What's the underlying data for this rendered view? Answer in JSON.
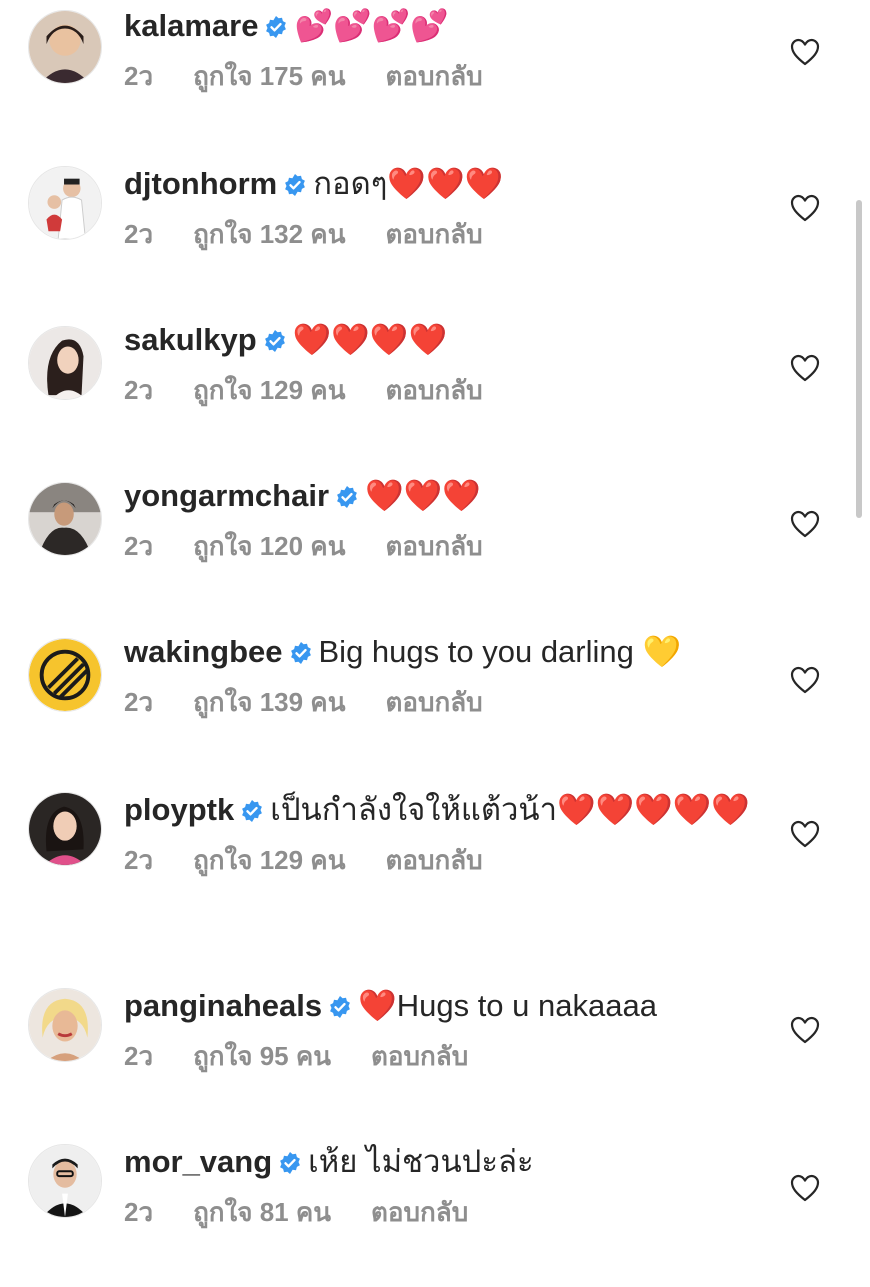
{
  "comments": [
    {
      "username": "kalamare",
      "text": "💕💕💕💕",
      "time": "2ว",
      "likes": "ถูกใจ 175 คน",
      "reply": "ตอบกลับ"
    },
    {
      "username": "djtonhorm",
      "text": "กอดๆ❤️❤️❤️",
      "time": "2ว",
      "likes": "ถูกใจ 132 คน",
      "reply": "ตอบกลับ"
    },
    {
      "username": "sakulkyp",
      "text": "❤️❤️❤️❤️",
      "time": "2ว",
      "likes": "ถูกใจ 129 คน",
      "reply": "ตอบกลับ"
    },
    {
      "username": "yongarmchair",
      "text": "❤️❤️❤️",
      "time": "2ว",
      "likes": "ถูกใจ 120 คน",
      "reply": "ตอบกลับ"
    },
    {
      "username": "wakingbee",
      "text": "Big hugs to you darling 💛",
      "time": "2ว",
      "likes": "ถูกใจ 139 คน",
      "reply": "ตอบกลับ"
    },
    {
      "username": "ployptk",
      "text": "เป็นกำลังใจให้แต้วน้า❤️❤️❤️❤️❤️",
      "time": "2ว",
      "likes": "ถูกใจ 129 คน",
      "reply": "ตอบกลับ"
    },
    {
      "username": "panginaheals",
      "text": "❤️Hugs to u nakaaaa",
      "time": "2ว",
      "likes": "ถูกใจ 95 คน",
      "reply": "ตอบกลับ"
    },
    {
      "username": "mor_vang",
      "text": "เห้ย ไม่ชวนปะล่ะ",
      "time": "2ว",
      "likes": "ถูกใจ 81 คน",
      "reply": "ตอบกลับ"
    }
  ],
  "icons": {
    "verified": "verified-badge-icon",
    "like": "heart-outline-icon"
  },
  "colors": {
    "verified": "#3897f0",
    "meta": "#8e8e8e",
    "text": "#262626"
  }
}
